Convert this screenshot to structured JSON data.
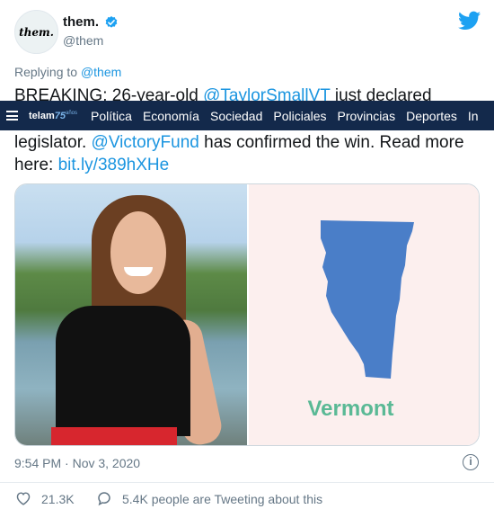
{
  "account": {
    "avatar_text": "them.",
    "display_name": "them.",
    "handle": "@them"
  },
  "replying_to": {
    "prefix": "Replying to ",
    "handle": "@them"
  },
  "tweet": {
    "line1_prefix": "BREAKING: 26-year-old ",
    "line1_mention": "@TaylorSmallVT",
    "line1_suffix": " just declared",
    "line2_prefix": "legislator. ",
    "line2_mention": "@VictoryFund",
    "line2_suffix": " has confirmed the win. Read more",
    "line3_prefix": "here: ",
    "line3_link": "bit.ly/389hXHe"
  },
  "overlay_nav": {
    "logo_text": "telam",
    "logo_number": "75",
    "logo_sub": "años",
    "items": [
      "Política",
      "Economía",
      "Sociedad",
      "Policiales",
      "Provincias",
      "Deportes",
      "In"
    ]
  },
  "media": {
    "map_label": "Vermont"
  },
  "meta": {
    "timestamp": "9:54 PM · Nov 3, 2020",
    "info_icon": "i"
  },
  "actions": {
    "like_count": "21.3K",
    "reply_text": "5.4K people are Tweeting about this"
  },
  "colors": {
    "link": "#1b95e0",
    "navbar_bg": "#13294b",
    "vermont_fill": "#4a7ec8",
    "vermont_label": "#5ab995",
    "map_panel_bg": "#fcefee",
    "twitter_blue": "#1da1f2"
  },
  "icons": [
    "verified-icon",
    "twitter-bird-icon",
    "hamburger-icon",
    "info-icon",
    "heart-icon",
    "speech-bubble-icon"
  ]
}
